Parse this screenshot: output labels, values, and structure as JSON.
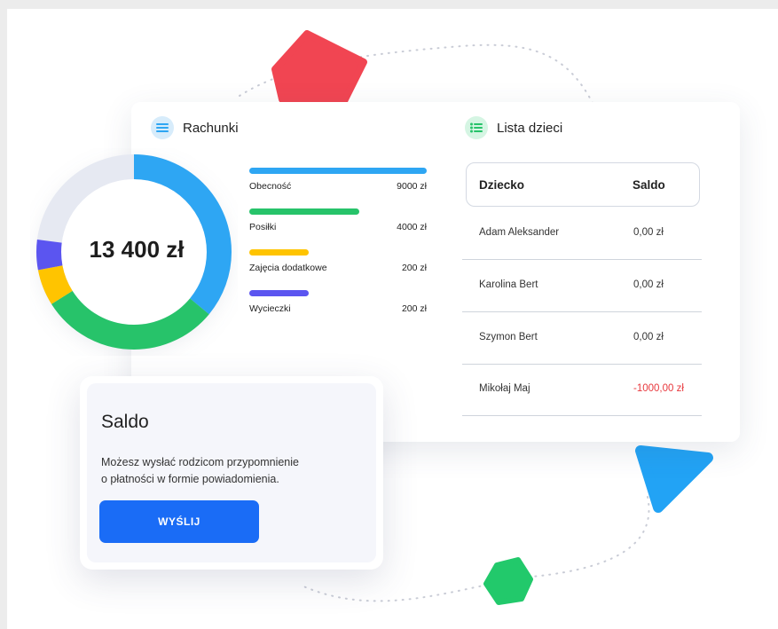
{
  "rachunki": {
    "title": "Rachunki",
    "icon": "list-icon",
    "total": "13 400 zł",
    "items": [
      {
        "label": "Obecność",
        "amount": "9000 zł",
        "value": 9000,
        "color": "#2ea6f3"
      },
      {
        "label": "Posiłki",
        "amount": "4000 zł",
        "value": 4000,
        "color": "#27c36a"
      },
      {
        "label": "Zajęcia dodatkowe",
        "amount": "200 zł",
        "value": 200,
        "color": "#ffc400"
      },
      {
        "label": "Wycieczki",
        "amount": "200 zł",
        "value": 200,
        "color": "#5b55f0"
      }
    ]
  },
  "lista": {
    "title": "Lista dzieci",
    "icon": "list-bullets-icon",
    "headers": {
      "name": "Dziecko",
      "saldo": "Saldo"
    },
    "rows": [
      {
        "name": "Adam Aleksander",
        "saldo": "0,00 zł"
      },
      {
        "name": "Karolina Bert",
        "saldo": "0,00 zł"
      },
      {
        "name": "Szymon Bert",
        "saldo": "0,00 zł"
      },
      {
        "name": "Mikołaj Maj",
        "saldo": "-1000,00 zł"
      }
    ]
  },
  "saldo": {
    "title": "Saldo",
    "line1": "Możesz wysłać rodzicom przypomnienie",
    "line2": "o płatności w formie powiadomienia.",
    "button": "WYŚLIJ"
  },
  "colors": {
    "accent": "#1a6cf6",
    "negative": "#e8383d",
    "shape_red": "#f14552",
    "shape_blue": "#22a3f5",
    "shape_green": "#22c96b"
  }
}
